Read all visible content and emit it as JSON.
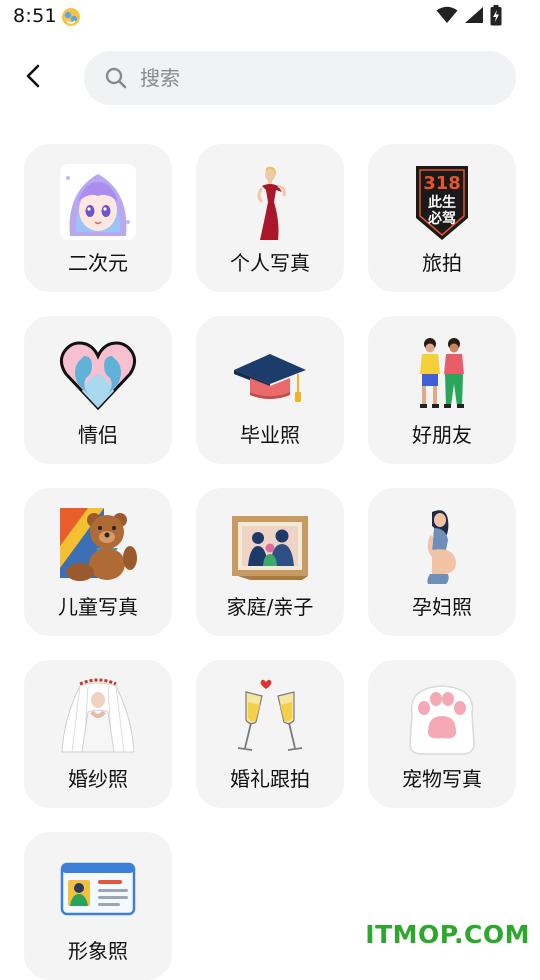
{
  "status_bar": {
    "time": "8:51",
    "icons": [
      "notification-badge-icon",
      "wifi-icon",
      "cellular-signal-icon",
      "battery-charging-icon"
    ]
  },
  "header": {
    "back_icon": "back-arrow-icon",
    "search": {
      "placeholder": "搜索",
      "value": ""
    }
  },
  "categories": [
    {
      "label": "二次元",
      "icon": "anime-girl-icon"
    },
    {
      "label": "个人写真",
      "icon": "red-dress-woman-icon"
    },
    {
      "label": "旅拍",
      "icon": "318-travel-badge-icon"
    },
    {
      "label": "情侣",
      "icon": "couple-heart-icon"
    },
    {
      "label": "毕业照",
      "icon": "graduation-cap-icon"
    },
    {
      "label": "好朋友",
      "icon": "two-friends-icon"
    },
    {
      "label": "儿童写真",
      "icon": "teddy-bear-icon"
    },
    {
      "label": "家庭/亲子",
      "icon": "family-photo-frame-icon"
    },
    {
      "label": "孕妇照",
      "icon": "pregnant-woman-icon"
    },
    {
      "label": "婚纱照",
      "icon": "wedding-veil-icon"
    },
    {
      "label": "婚礼跟拍",
      "icon": "champagne-toast-icon"
    },
    {
      "label": "宠物写真",
      "icon": "cat-paw-icon"
    },
    {
      "label": "形象照",
      "icon": "id-card-icon"
    }
  ],
  "badge_318": {
    "top": "318",
    "line1": "此生",
    "line2": "必驾"
  },
  "watermark": "ITMOP.COM",
  "colors": {
    "card_bg": "#f4f4f5",
    "search_bg": "#f1f2f4",
    "watermark": "#2da82d"
  }
}
